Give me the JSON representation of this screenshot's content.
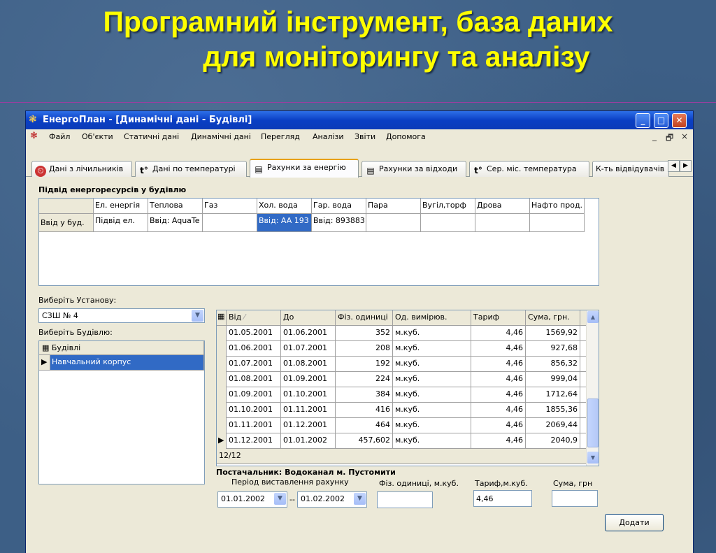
{
  "slide": {
    "title_line1": "Програмний інструмент, база даних",
    "title_line2": "для моніторингу та аналізу"
  },
  "window": {
    "title": "ЕнергоПлан - [Динамічні дані - Будівлі]",
    "minimize": "_",
    "maximize": "□",
    "close": "✕"
  },
  "menu": [
    "Файл",
    "Об'єкти",
    "Статичні дані",
    "Динамічні дані",
    "Перегляд",
    "Аналізи",
    "Звіти",
    "Допомога"
  ],
  "mdi": {
    "min": "_",
    "restore": "🗗",
    "close": "×"
  },
  "tabs": [
    {
      "label": "Дані з лічильників",
      "icon": "⏲"
    },
    {
      "label": "Дані по температурі",
      "icon": "t°"
    },
    {
      "label": "Рахунки за енергію",
      "icon": "▤"
    },
    {
      "label": "Рахунки за відходи",
      "icon": "▤"
    },
    {
      "label": "Сер. міс. температура",
      "icon": "t°"
    },
    {
      "label": "К-ть відвідувачів",
      "icon": ""
    }
  ],
  "tab_arrows": {
    "left": "◀",
    "right": "▶"
  },
  "supply": {
    "heading": "Підвід енергоресурсів у будівлю",
    "columns": [
      "Ел. енергія",
      "Теплова",
      "Газ",
      "Хол. вода",
      "Гар. вода",
      "Пара",
      "Вугіл,торф",
      "Дрова",
      "Нафто прод."
    ],
    "row_label": "Ввід у буд.",
    "row_values": [
      "Підвід ел.",
      "Ввід: AquaTe",
      "",
      "Ввід: AA 193",
      "Ввід: 893883",
      "",
      "",
      "",
      ""
    ]
  },
  "institution": {
    "label": "Виберіть Установу:",
    "value": "СЗШ №  4"
  },
  "building": {
    "label": "Виберіть Будівлю:",
    "header": "Будівлі",
    "items": [
      "Навчальний корпус"
    ]
  },
  "bills": {
    "columns": [
      "Від",
      "До",
      "Фіз. одиниці",
      "Од. вимірюв.",
      "Тариф",
      "Сума, грн."
    ],
    "sort_mark": "⁄",
    "rows": [
      [
        "01.05.2001",
        "01.06.2001",
        "352",
        "м.куб.",
        "4,46",
        "1569,92"
      ],
      [
        "01.06.2001",
        "01.07.2001",
        "208",
        "м.куб.",
        "4,46",
        "927,68"
      ],
      [
        "01.07.2001",
        "01.08.2001",
        "192",
        "м.куб.",
        "4,46",
        "856,32"
      ],
      [
        "01.08.2001",
        "01.09.2001",
        "224",
        "м.куб.",
        "4,46",
        "999,04"
      ],
      [
        "01.09.2001",
        "01.10.2001",
        "384",
        "м.куб.",
        "4,46",
        "1712,64"
      ],
      [
        "01.10.2001",
        "01.11.2001",
        "416",
        "м.куб.",
        "4,46",
        "1855,36"
      ],
      [
        "01.11.2001",
        "01.12.2001",
        "464",
        "м.куб.",
        "4,46",
        "2069,44"
      ],
      [
        "01.12.2001",
        "01.01.2002",
        "457,602",
        "м.куб.",
        "4,46",
        "2040,9"
      ]
    ],
    "counter": "12/12"
  },
  "form": {
    "supplier": "Постачальник: Водоканал м. Пустомити",
    "period_label": "Період виставлення рахунку",
    "units_label": "Фіз. одиниці, м.куб.",
    "tariff_label": "Тариф,м.куб.",
    "sum_label": "Сума, грн",
    "date_from": "01.01.2002",
    "dash": "--",
    "date_to": "01.02.2002",
    "units_value": "",
    "tariff_value": "4,46",
    "sum_value": "",
    "add_button": "Додати"
  }
}
